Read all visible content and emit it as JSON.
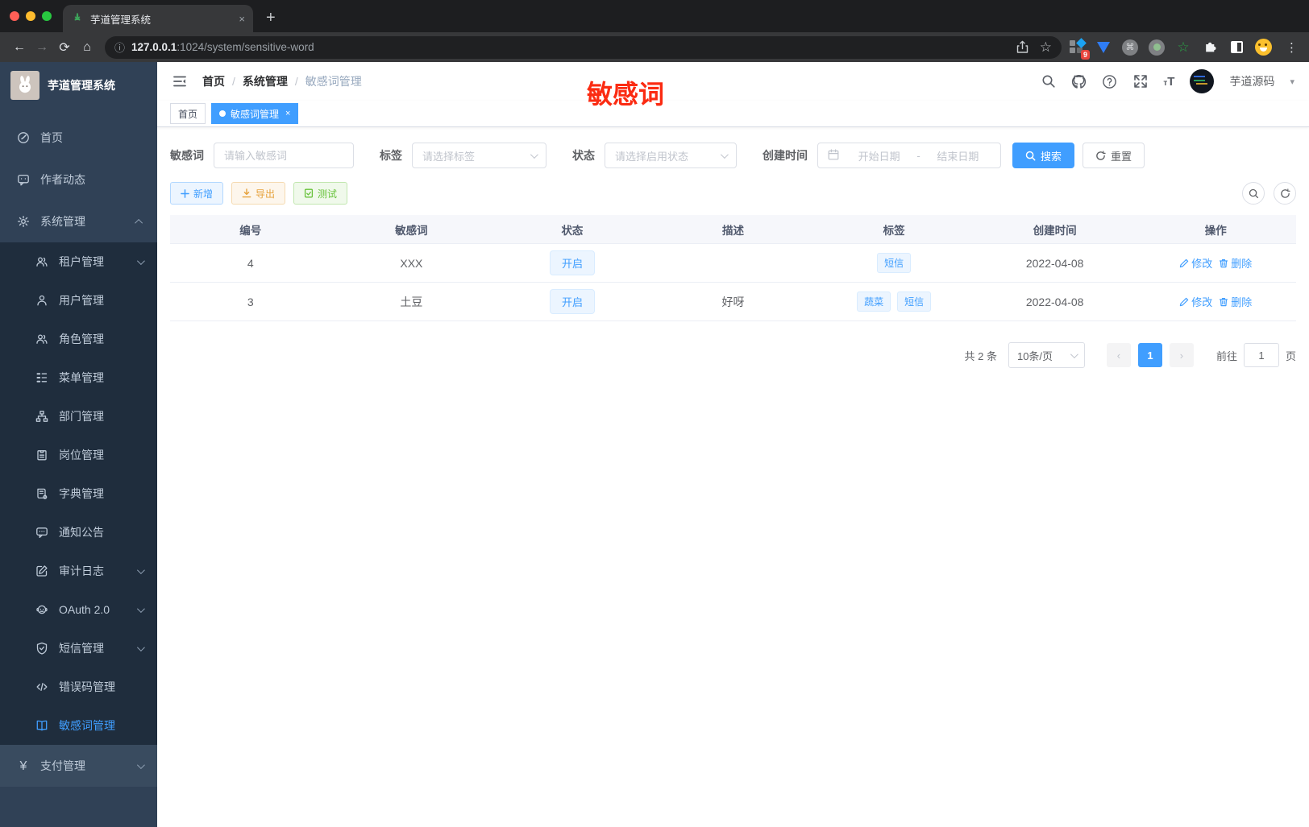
{
  "colors": {
    "accent": "#409eff",
    "annotation_red": "#fb2b12",
    "warning": "#e6a23c",
    "success": "#67c23a"
  },
  "browser": {
    "tab_title": "芋道管理系统",
    "url_host": "127.0.0.1",
    "url_rest": ":1024/system/sensitive-word",
    "extensions_badge": "9"
  },
  "icons": {
    "back": "←",
    "forward": "→",
    "reload": "⟳",
    "home": "⌂",
    "info": "ⓘ",
    "star": "☆",
    "menu_dots": "⋮",
    "new_tab": "+",
    "close": "×",
    "cmd": "⌘",
    "star_ext": "☆",
    "tab_dot": "",
    "caret": "▾",
    "crumb_sep": "/",
    "yen": "¥",
    "font_small": "т",
    "font_big": "T",
    "prev": "‹",
    "next": "›"
  },
  "annotation": {
    "text": "敏感词"
  },
  "sidebar": {
    "logo_title": "芋道管理系统",
    "items": [
      {
        "label": "首页"
      },
      {
        "label": "作者动态"
      },
      {
        "label": "系统管理"
      },
      {
        "label": "租户管理"
      },
      {
        "label": "用户管理"
      },
      {
        "label": "角色管理"
      },
      {
        "label": "菜单管理"
      },
      {
        "label": "部门管理"
      },
      {
        "label": "岗位管理"
      },
      {
        "label": "字典管理"
      },
      {
        "label": "通知公告"
      },
      {
        "label": "审计日志"
      },
      {
        "label": "OAuth 2.0"
      },
      {
        "label": "短信管理"
      },
      {
        "label": "错误码管理"
      },
      {
        "label": "敏感词管理"
      },
      {
        "label": "支付管理"
      }
    ]
  },
  "header": {
    "breadcrumb": [
      "首页",
      "系统管理",
      "敏感词管理"
    ],
    "username": "芋道源码"
  },
  "tabbar": {
    "tabs": [
      {
        "label": "首页"
      },
      {
        "label": "敏感词管理"
      }
    ]
  },
  "filters": {
    "keyword_label": "敏感词",
    "keyword_placeholder": "请输入敏感词",
    "tag_label": "标签",
    "tag_placeholder": "请选择标签",
    "status_label": "状态",
    "status_placeholder": "请选择启用状态",
    "date_label": "创建时间",
    "date_start": "开始日期",
    "date_separator": "-",
    "date_end": "结束日期",
    "search_label": "搜索",
    "reset_label": "重置"
  },
  "toolbar": {
    "add_label": "新增",
    "export_label": "导出",
    "test_label": "测试"
  },
  "table": {
    "columns": [
      "编号",
      "敏感词",
      "状态",
      "描述",
      "标签",
      "创建时间",
      "操作"
    ],
    "rows": [
      {
        "id": "4",
        "word": "XXX",
        "status": "开启",
        "desc": "",
        "tags": [
          "短信"
        ],
        "created": "2022-04-08",
        "edit": "修改",
        "del": "删除"
      },
      {
        "id": "3",
        "word": "土豆",
        "status": "开启",
        "desc": "好呀",
        "tags": [
          "蔬菜",
          "短信"
        ],
        "created": "2022-04-08",
        "edit": "修改",
        "del": "删除"
      }
    ]
  },
  "pagination": {
    "total": "共 2 条",
    "page_size": "10条/页",
    "current_page": "1",
    "goto_label": "前往",
    "goto_value": "1",
    "page_suffix": "页"
  }
}
